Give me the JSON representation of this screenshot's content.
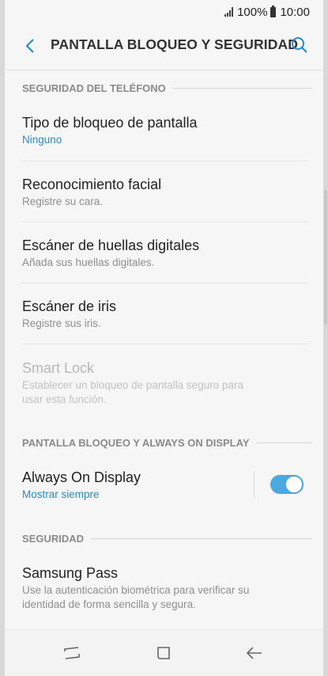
{
  "status_bar": {
    "battery_percent": "100%",
    "time": "10:00"
  },
  "header": {
    "title": "PANTALLA BLOQUEO Y SEGURIDAD"
  },
  "sections": [
    {
      "header": "SEGURIDAD DEL TELÉFONO",
      "items": [
        {
          "title": "Tipo de bloqueo de pantalla",
          "subtitle": "Ninguno"
        },
        {
          "title": "Reconocimiento facial",
          "subtitle": "Registre su cara."
        },
        {
          "title": "Escáner de huellas digitales",
          "subtitle": "Añada sus huellas digitales."
        },
        {
          "title": "Escáner de iris",
          "subtitle": "Registre sus iris."
        },
        {
          "title": "Smart Lock",
          "subtitle_line1": "Establecer un bloqueo de pantalla seguro para",
          "subtitle_line2": "usar esta función."
        }
      ]
    },
    {
      "header": "PANTALLA BLOQUEO Y ALWAYS ON DISPLAY",
      "items": [
        {
          "title": "Always On Display",
          "subtitle": "Mostrar siempre",
          "toggle_on": true
        }
      ]
    },
    {
      "header": "SEGURIDAD",
      "items": [
        {
          "title": "Samsung Pass",
          "subtitle_line1": "Use la autenticación biométrica para verificar su",
          "subtitle_line2": "identidad de forma sencilla y segura."
        }
      ]
    }
  ],
  "colors": {
    "accent": "#2b8cc4",
    "toggle": "#4aa9de",
    "background": "#f6f6f6"
  },
  "icons": {
    "back": "chevron-left-icon",
    "search": "search-icon",
    "recent": "recent-apps-icon",
    "home": "home-icon",
    "nav_back": "arrow-left-icon"
  }
}
